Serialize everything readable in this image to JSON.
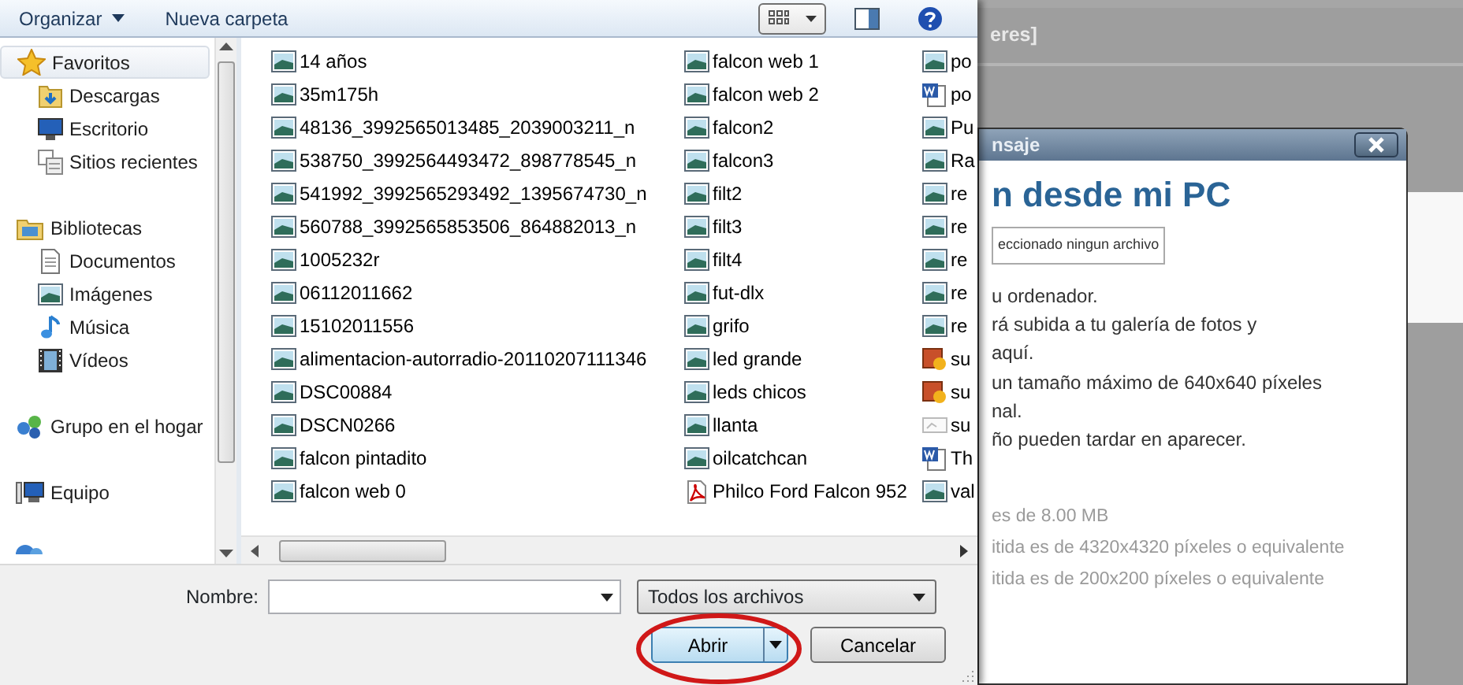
{
  "toolbar": {
    "buttons": [
      {
        "label": "Organizar",
        "has_menu": true
      },
      {
        "label": "Nueva carpeta",
        "has_menu": false
      }
    ]
  },
  "sidebar": {
    "groups": [
      {
        "label": "Favoritos",
        "kind": "star",
        "selected": true,
        "children": [
          {
            "label": "Descargas",
            "kind": "downloads",
            "selected": false
          },
          {
            "label": "Escritorio",
            "kind": "desktop",
            "selected": false
          },
          {
            "label": "Sitios recientes",
            "kind": "recent",
            "selected": false
          }
        ]
      },
      {
        "label": "Bibliotecas",
        "kind": "library",
        "selected": false,
        "children": [
          {
            "label": "Documentos",
            "kind": "document",
            "selected": false
          },
          {
            "label": "Imágenes",
            "kind": "image",
            "selected": false
          },
          {
            "label": "Música",
            "kind": "music",
            "selected": false
          },
          {
            "label": "Vídeos",
            "kind": "video",
            "selected": false
          }
        ]
      },
      {
        "label": "Grupo en el hogar",
        "kind": "homegroup",
        "selected": false
      },
      {
        "label": "Equipo",
        "kind": "computer",
        "selected": false
      }
    ]
  },
  "files": {
    "columns": [
      [
        {
          "name": "14 años",
          "kind": "image"
        },
        {
          "name": "35m175h",
          "kind": "image"
        },
        {
          "name": "48136_3992565013485_2039003211_n",
          "kind": "image"
        },
        {
          "name": "538750_3992564493472_898778545_n",
          "kind": "image"
        },
        {
          "name": "541992_3992565293492_1395674730_n",
          "kind": "image"
        },
        {
          "name": "560788_3992565853506_864882013_n",
          "kind": "image"
        },
        {
          "name": "1005232r",
          "kind": "image"
        },
        {
          "name": "06112011662",
          "kind": "image"
        },
        {
          "name": "15102011556",
          "kind": "image"
        },
        {
          "name": "alimentacion-autorradio-20110207111346",
          "kind": "image"
        },
        {
          "name": "DSC00884",
          "kind": "image"
        },
        {
          "name": "DSCN0266",
          "kind": "image"
        },
        {
          "name": "falcon pintadito",
          "kind": "image"
        },
        {
          "name": "falcon web 0",
          "kind": "image"
        }
      ],
      [
        {
          "name": "falcon web 1",
          "kind": "image"
        },
        {
          "name": "falcon web 2",
          "kind": "image"
        },
        {
          "name": "falcon2",
          "kind": "image"
        },
        {
          "name": "falcon3",
          "kind": "image"
        },
        {
          "name": "filt2",
          "kind": "image"
        },
        {
          "name": "filt3",
          "kind": "image"
        },
        {
          "name": "filt4",
          "kind": "image"
        },
        {
          "name": "fut-dlx",
          "kind": "image"
        },
        {
          "name": "grifo",
          "kind": "image"
        },
        {
          "name": "led grande",
          "kind": "image"
        },
        {
          "name": "leds chicos",
          "kind": "image"
        },
        {
          "name": "llanta",
          "kind": "image"
        },
        {
          "name": "oilcatchcan",
          "kind": "image"
        },
        {
          "name": "Philco Ford Falcon 952",
          "kind": "pdf"
        }
      ],
      [
        {
          "name": "po",
          "kind": "image"
        },
        {
          "name": "po",
          "kind": "word"
        },
        {
          "name": "Pu",
          "kind": "image"
        },
        {
          "name": "Ra",
          "kind": "image"
        },
        {
          "name": "re",
          "kind": "image"
        },
        {
          "name": "re",
          "kind": "image"
        },
        {
          "name": "re",
          "kind": "image"
        },
        {
          "name": "re",
          "kind": "image"
        },
        {
          "name": "re",
          "kind": "image"
        },
        {
          "name": "su",
          "kind": "picture"
        },
        {
          "name": "su",
          "kind": "picture"
        },
        {
          "name": "su",
          "kind": "generic"
        },
        {
          "name": "Th",
          "kind": "word"
        },
        {
          "name": "val",
          "kind": "image"
        }
      ]
    ]
  },
  "file_name": {
    "label": "Nombre:"
  },
  "file_type": {
    "value": "Todos los archivos"
  },
  "buttons": [
    {
      "label": "Abrir",
      "kind": "split",
      "default": true
    },
    {
      "label": "Cancelar",
      "kind": "plain",
      "default": false
    }
  ],
  "background_page": {
    "header_text": "eres]",
    "dialog": {
      "title": "nsaje",
      "heading": "n desde mi PC",
      "file_input_text": "eccionado ningun archivo",
      "paragraph_lines": [
        "u ordenador.",
        "rá subida a tu galería de fotos y",
        "aquí.",
        "un tamaño máximo de 640x640 píxeles",
        "nal.",
        "ño pueden tardar en aparecer."
      ],
      "note_lines": [
        "es de 8.00 MB",
        "itida es de 4320x4320 píxeles o equivalente",
        "itida es de 200x200 píxeles o equivalente"
      ]
    }
  }
}
